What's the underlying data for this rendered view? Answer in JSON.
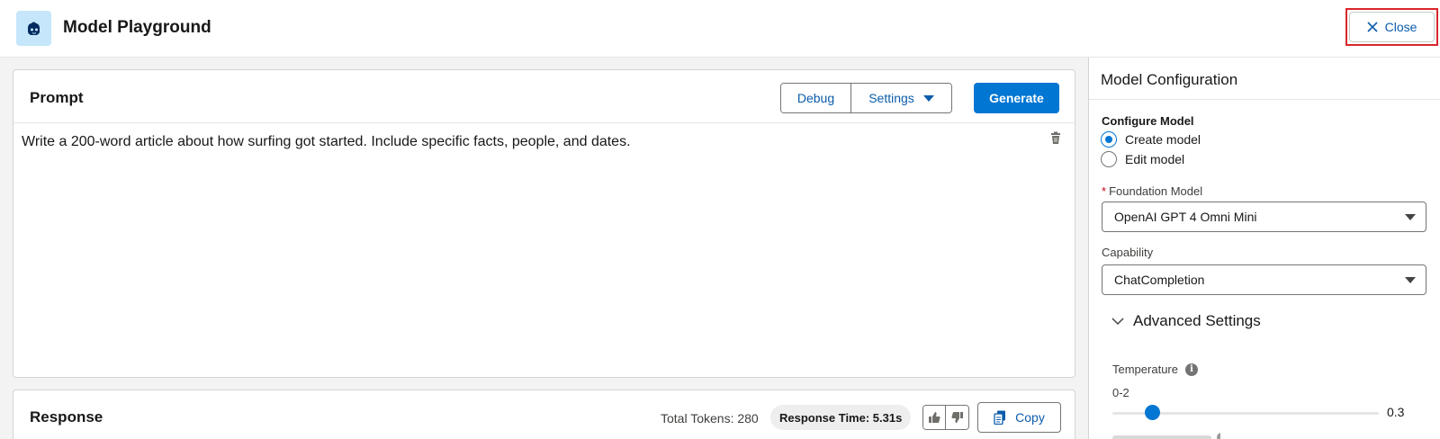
{
  "header": {
    "title": "Model Playground",
    "close_label": "Close",
    "app_icon": "einstein-icon"
  },
  "prompt": {
    "title": "Prompt",
    "debug_label": "Debug",
    "settings_label": "Settings",
    "generate_label": "Generate",
    "text": "Write a 200-word article about how surfing got started. Include specific facts, people, and dates."
  },
  "response": {
    "title": "Response",
    "total_tokens": "Total Tokens: 280",
    "response_time": "Response Time: 5.31s",
    "copy_label": "Copy"
  },
  "config": {
    "title": "Model Configuration",
    "configure_label": "Configure Model",
    "options": [
      "Create model",
      "Edit model"
    ],
    "selected_option": "Create model",
    "foundation_label": "Foundation Model",
    "foundation_required": "*",
    "foundation_value": "OpenAI GPT 4 Omni Mini",
    "capability_label": "Capability",
    "capability_value": "ChatCompletion",
    "advanced_label": "Advanced Settings",
    "temperature_label": "Temperature",
    "temperature_range": "0-2",
    "temperature_value": "0.3",
    "temperature_fraction": 0.15
  },
  "colors": {
    "brand": "#0176d3",
    "link": "#0b5cab",
    "highlight": "#d8262b"
  }
}
